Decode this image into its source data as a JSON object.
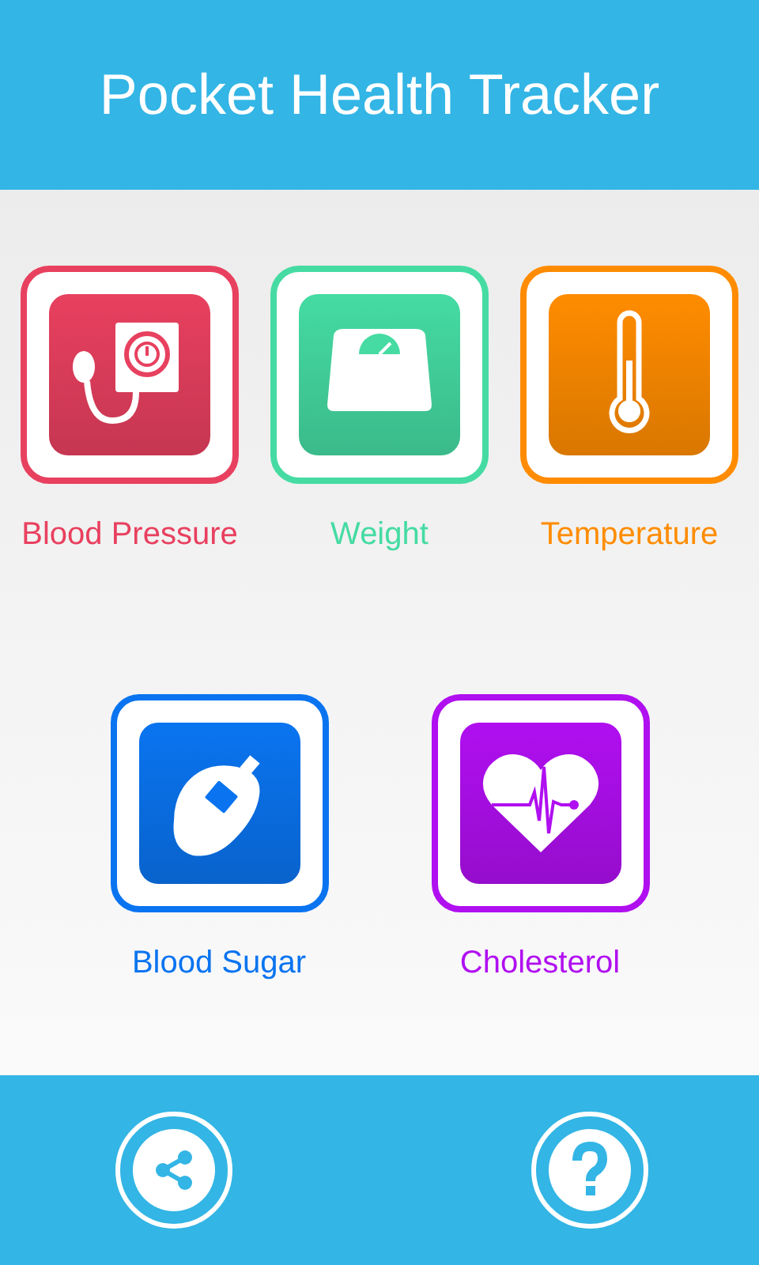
{
  "header": {
    "title": "Pocket Health Tracker"
  },
  "rows": [
    [
      {
        "label": "Blood Pressure",
        "kind": "pressure",
        "color": "#e8405f"
      },
      {
        "label": "Weight",
        "kind": "scale",
        "color": "#45dba3"
      },
      {
        "label": "Temperature",
        "kind": "thermometer",
        "color": "#ff8c00"
      }
    ],
    [
      {
        "label": "Blood Sugar",
        "kind": "glucose",
        "color": "#0a74f0"
      },
      {
        "label": "Cholesterol",
        "kind": "heart",
        "color": "#b00ff0"
      }
    ]
  ],
  "footer": {
    "buttons": [
      {
        "kind": "share"
      },
      {
        "kind": "help"
      }
    ]
  }
}
